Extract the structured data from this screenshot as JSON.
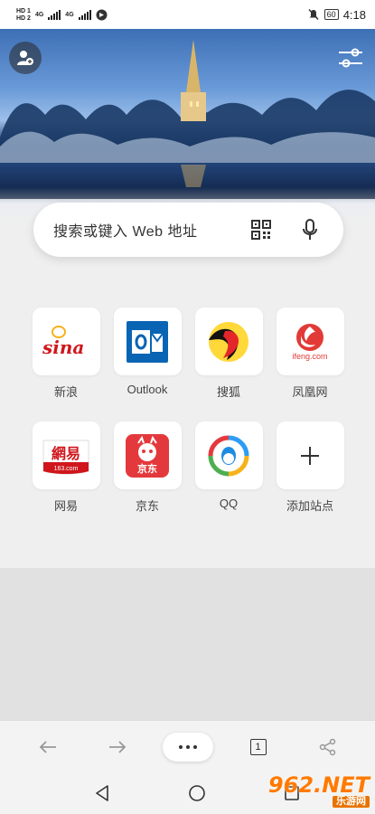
{
  "status_bar": {
    "sim1": "HD 1",
    "sim2": "HD 2",
    "net1": "4G",
    "net2": "4G",
    "battery": "60",
    "time": "4:18",
    "icons": [
      "mute-icon",
      "battery-icon",
      "signal-icon",
      "vpn-icon"
    ]
  },
  "search": {
    "placeholder": "搜索或键入 Web 地址"
  },
  "shortcuts": [
    {
      "label": "新浪",
      "icon": "sina-logo"
    },
    {
      "label": "Outlook",
      "icon": "outlook-logo"
    },
    {
      "label": "搜狐",
      "icon": "sohu-logo"
    },
    {
      "label": "凤凰网",
      "icon": "ifeng-logo"
    },
    {
      "label": "网易",
      "icon": "netease-logo"
    },
    {
      "label": "京东",
      "icon": "jd-logo"
    },
    {
      "label": "QQ",
      "icon": "qq-logo"
    },
    {
      "label": "添加站点",
      "icon": "plus-icon"
    }
  ],
  "logo_text": {
    "sina": "sina",
    "ifeng": "ifeng.com",
    "netease": "網易",
    "netease_sub": "163.com",
    "jd": "京东"
  },
  "toolbar": {
    "tab_count": "1",
    "icons": [
      "back-arrow-icon",
      "forward-arrow-icon",
      "more-icon",
      "tabs-icon",
      "share-icon"
    ]
  },
  "watermark": {
    "main": "962.NET",
    "sub": "乐游网"
  },
  "colors": {
    "accent_orange": "#ff7a00",
    "outlook_blue": "#0a64b4",
    "jd_red": "#e4393c"
  }
}
